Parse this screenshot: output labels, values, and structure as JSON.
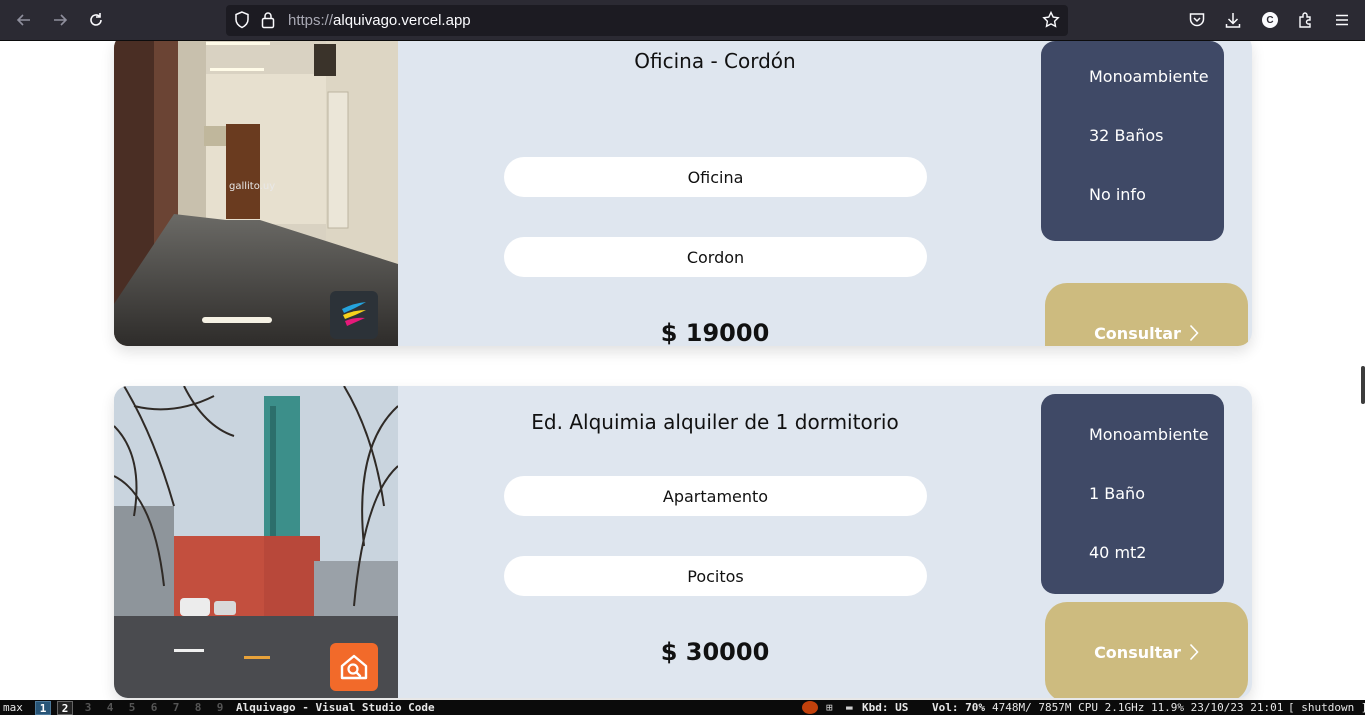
{
  "browser": {
    "url_scheme": "https://",
    "url_host": "alquivago.vercel.app",
    "profile_initial": "C",
    "icons": [
      "back-icon",
      "forward-icon",
      "reload-icon",
      "shield-icon",
      "lock-icon",
      "bookmark-star-icon",
      "pocket-icon",
      "downloads-icon",
      "account-icon",
      "extensions-icon",
      "menu-icon"
    ]
  },
  "listings": [
    {
      "title": "Oficina - Cordón",
      "type": "Oficina",
      "neighborhood": "Cordon",
      "price": "$ 19000",
      "rooms": "Monoambiente",
      "baths": "32 Baños",
      "area": "No info",
      "cta": "Consultar",
      "source_badge": "gallito-logo",
      "watermark": "gallito.uy"
    },
    {
      "title": "Ed. Alquimia alquiler de 1 dormitorio",
      "type": "Apartamento",
      "neighborhood": "Pocitos",
      "price": "$ 30000",
      "rooms": "Monoambiente",
      "baths": "1 Baño",
      "area": "40 mt2",
      "cta": "Consultar",
      "source_badge": "infocasas-logo"
    }
  ],
  "taskbar": {
    "mode": "max",
    "workspaces": [
      "1",
      "2",
      "3",
      "4",
      "5",
      "6",
      "7",
      "8",
      "9"
    ],
    "active_workspace": "1",
    "window_title": "Alquivago - Visual Studio Code",
    "kbd": "Kbd: US",
    "volume": "Vol: 70%",
    "stats": "4748M/ 7857M  CPU 2.1GHz 11.9%  23/10/23 21:01",
    "shutdown": "[ shutdown ]"
  },
  "colors": {
    "card_bg": "#dfe6ef",
    "info_bg": "#3f4966",
    "cta_bg": "#cdbb7f",
    "chrome_bg": "#2b2a33"
  }
}
